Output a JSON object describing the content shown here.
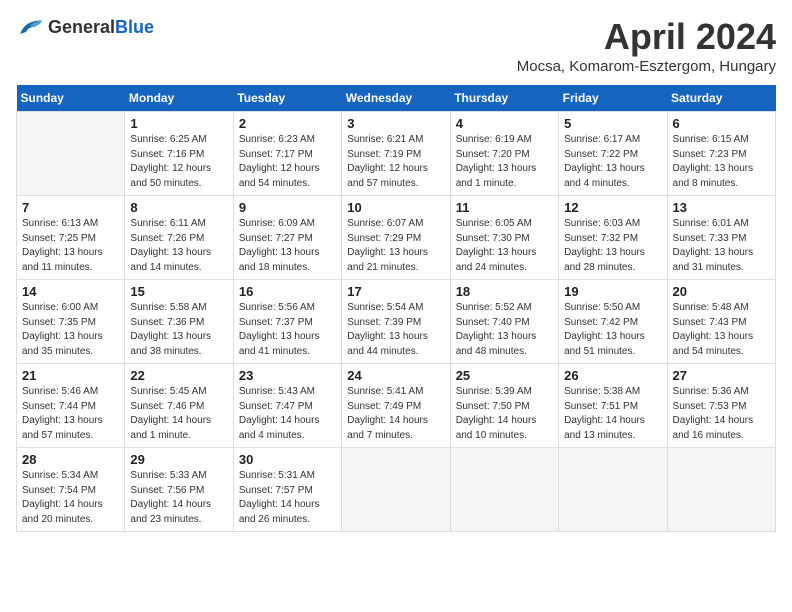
{
  "header": {
    "logo_general": "General",
    "logo_blue": "Blue",
    "month_year": "April 2024",
    "location": "Mocsa, Komarom-Esztergom, Hungary"
  },
  "weekdays": [
    "Sunday",
    "Monday",
    "Tuesday",
    "Wednesday",
    "Thursday",
    "Friday",
    "Saturday"
  ],
  "weeks": [
    [
      {
        "day": "",
        "sunrise": "",
        "sunset": "",
        "daylight": "",
        "empty": true
      },
      {
        "day": "1",
        "sunrise": "Sunrise: 6:25 AM",
        "sunset": "Sunset: 7:16 PM",
        "daylight": "Daylight: 12 hours and 50 minutes."
      },
      {
        "day": "2",
        "sunrise": "Sunrise: 6:23 AM",
        "sunset": "Sunset: 7:17 PM",
        "daylight": "Daylight: 12 hours and 54 minutes."
      },
      {
        "day": "3",
        "sunrise": "Sunrise: 6:21 AM",
        "sunset": "Sunset: 7:19 PM",
        "daylight": "Daylight: 12 hours and 57 minutes."
      },
      {
        "day": "4",
        "sunrise": "Sunrise: 6:19 AM",
        "sunset": "Sunset: 7:20 PM",
        "daylight": "Daylight: 13 hours and 1 minute."
      },
      {
        "day": "5",
        "sunrise": "Sunrise: 6:17 AM",
        "sunset": "Sunset: 7:22 PM",
        "daylight": "Daylight: 13 hours and 4 minutes."
      },
      {
        "day": "6",
        "sunrise": "Sunrise: 6:15 AM",
        "sunset": "Sunset: 7:23 PM",
        "daylight": "Daylight: 13 hours and 8 minutes."
      }
    ],
    [
      {
        "day": "7",
        "sunrise": "Sunrise: 6:13 AM",
        "sunset": "Sunset: 7:25 PM",
        "daylight": "Daylight: 13 hours and 11 minutes."
      },
      {
        "day": "8",
        "sunrise": "Sunrise: 6:11 AM",
        "sunset": "Sunset: 7:26 PM",
        "daylight": "Daylight: 13 hours and 14 minutes."
      },
      {
        "day": "9",
        "sunrise": "Sunrise: 6:09 AM",
        "sunset": "Sunset: 7:27 PM",
        "daylight": "Daylight: 13 hours and 18 minutes."
      },
      {
        "day": "10",
        "sunrise": "Sunrise: 6:07 AM",
        "sunset": "Sunset: 7:29 PM",
        "daylight": "Daylight: 13 hours and 21 minutes."
      },
      {
        "day": "11",
        "sunrise": "Sunrise: 6:05 AM",
        "sunset": "Sunset: 7:30 PM",
        "daylight": "Daylight: 13 hours and 24 minutes."
      },
      {
        "day": "12",
        "sunrise": "Sunrise: 6:03 AM",
        "sunset": "Sunset: 7:32 PM",
        "daylight": "Daylight: 13 hours and 28 minutes."
      },
      {
        "day": "13",
        "sunrise": "Sunrise: 6:01 AM",
        "sunset": "Sunset: 7:33 PM",
        "daylight": "Daylight: 13 hours and 31 minutes."
      }
    ],
    [
      {
        "day": "14",
        "sunrise": "Sunrise: 6:00 AM",
        "sunset": "Sunset: 7:35 PM",
        "daylight": "Daylight: 13 hours and 35 minutes."
      },
      {
        "day": "15",
        "sunrise": "Sunrise: 5:58 AM",
        "sunset": "Sunset: 7:36 PM",
        "daylight": "Daylight: 13 hours and 38 minutes."
      },
      {
        "day": "16",
        "sunrise": "Sunrise: 5:56 AM",
        "sunset": "Sunset: 7:37 PM",
        "daylight": "Daylight: 13 hours and 41 minutes."
      },
      {
        "day": "17",
        "sunrise": "Sunrise: 5:54 AM",
        "sunset": "Sunset: 7:39 PM",
        "daylight": "Daylight: 13 hours and 44 minutes."
      },
      {
        "day": "18",
        "sunrise": "Sunrise: 5:52 AM",
        "sunset": "Sunset: 7:40 PM",
        "daylight": "Daylight: 13 hours and 48 minutes."
      },
      {
        "day": "19",
        "sunrise": "Sunrise: 5:50 AM",
        "sunset": "Sunset: 7:42 PM",
        "daylight": "Daylight: 13 hours and 51 minutes."
      },
      {
        "day": "20",
        "sunrise": "Sunrise: 5:48 AM",
        "sunset": "Sunset: 7:43 PM",
        "daylight": "Daylight: 13 hours and 54 minutes."
      }
    ],
    [
      {
        "day": "21",
        "sunrise": "Sunrise: 5:46 AM",
        "sunset": "Sunset: 7:44 PM",
        "daylight": "Daylight: 13 hours and 57 minutes."
      },
      {
        "day": "22",
        "sunrise": "Sunrise: 5:45 AM",
        "sunset": "Sunset: 7:46 PM",
        "daylight": "Daylight: 14 hours and 1 minute."
      },
      {
        "day": "23",
        "sunrise": "Sunrise: 5:43 AM",
        "sunset": "Sunset: 7:47 PM",
        "daylight": "Daylight: 14 hours and 4 minutes."
      },
      {
        "day": "24",
        "sunrise": "Sunrise: 5:41 AM",
        "sunset": "Sunset: 7:49 PM",
        "daylight": "Daylight: 14 hours and 7 minutes."
      },
      {
        "day": "25",
        "sunrise": "Sunrise: 5:39 AM",
        "sunset": "Sunset: 7:50 PM",
        "daylight": "Daylight: 14 hours and 10 minutes."
      },
      {
        "day": "26",
        "sunrise": "Sunrise: 5:38 AM",
        "sunset": "Sunset: 7:51 PM",
        "daylight": "Daylight: 14 hours and 13 minutes."
      },
      {
        "day": "27",
        "sunrise": "Sunrise: 5:36 AM",
        "sunset": "Sunset: 7:53 PM",
        "daylight": "Daylight: 14 hours and 16 minutes."
      }
    ],
    [
      {
        "day": "28",
        "sunrise": "Sunrise: 5:34 AM",
        "sunset": "Sunset: 7:54 PM",
        "daylight": "Daylight: 14 hours and 20 minutes."
      },
      {
        "day": "29",
        "sunrise": "Sunrise: 5:33 AM",
        "sunset": "Sunset: 7:56 PM",
        "daylight": "Daylight: 14 hours and 23 minutes."
      },
      {
        "day": "30",
        "sunrise": "Sunrise: 5:31 AM",
        "sunset": "Sunset: 7:57 PM",
        "daylight": "Daylight: 14 hours and 26 minutes."
      },
      {
        "day": "",
        "sunrise": "",
        "sunset": "",
        "daylight": "",
        "empty": true
      },
      {
        "day": "",
        "sunrise": "",
        "sunset": "",
        "daylight": "",
        "empty": true
      },
      {
        "day": "",
        "sunrise": "",
        "sunset": "",
        "daylight": "",
        "empty": true
      },
      {
        "day": "",
        "sunrise": "",
        "sunset": "",
        "daylight": "",
        "empty": true
      }
    ]
  ]
}
